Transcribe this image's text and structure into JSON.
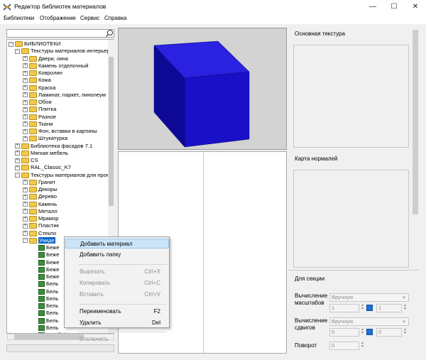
{
  "window": {
    "title": "Редактор библиотек материалов",
    "minimize": "—",
    "maximize": "☐",
    "close": "✕"
  },
  "menu": [
    "Библиотеки",
    "Отображение",
    "Сервис",
    "Справка"
  ],
  "tree": [
    {
      "label": "БИБЛИОТЕКИ",
      "exp": "−",
      "level": 0
    },
    {
      "label": "Текстуры материалов интерьер",
      "exp": "−",
      "level": 1
    },
    {
      "label": "Двери, окна",
      "exp": "+",
      "level": 2
    },
    {
      "label": "Камень отделочный",
      "exp": "+",
      "level": 2
    },
    {
      "label": "Ковролин",
      "exp": "+",
      "level": 2
    },
    {
      "label": "Кожа",
      "exp": "+",
      "level": 2
    },
    {
      "label": "Краска",
      "exp": "+",
      "level": 2
    },
    {
      "label": "Ламинат, паркет, линолеум",
      "exp": "+",
      "level": 2
    },
    {
      "label": "Обои",
      "exp": "+",
      "level": 2
    },
    {
      "label": "Плитка",
      "exp": "+",
      "level": 2
    },
    {
      "label": "Разное",
      "exp": "+",
      "level": 2
    },
    {
      "label": "Ткани",
      "exp": "+",
      "level": 2
    },
    {
      "label": "Фон, вставки в картины",
      "exp": "+",
      "level": 2
    },
    {
      "label": "Штукатурка",
      "exp": "+",
      "level": 2
    },
    {
      "label": "Библиотека фасадов 7.1",
      "exp": "+",
      "level": 1
    },
    {
      "label": "Мягкая мебель",
      "exp": "+",
      "level": 1
    },
    {
      "label": "CS",
      "exp": "+",
      "level": 1
    },
    {
      "label": "RAL_Classic_K7",
      "exp": "+",
      "level": 1
    },
    {
      "label": "Текстуры материалов для прое",
      "exp": "−",
      "level": 1
    },
    {
      "label": "Гранит",
      "exp": "+",
      "level": 2
    },
    {
      "label": "Декоры",
      "exp": "+",
      "level": 2
    },
    {
      "label": "Дерево",
      "exp": "+",
      "level": 2
    },
    {
      "label": "Камень",
      "exp": "+",
      "level": 2
    },
    {
      "label": "Металл",
      "exp": "+",
      "level": 2
    },
    {
      "label": "Мрамор",
      "exp": "+",
      "level": 2
    },
    {
      "label": "Пластик",
      "exp": "+",
      "level": 2
    },
    {
      "label": "Стекло",
      "exp": "+",
      "level": 2
    },
    {
      "label": "Униде",
      "exp": "−",
      "level": 2,
      "selected": true
    },
    {
      "label": "Беже",
      "level": 3,
      "material": true
    },
    {
      "label": "Беже",
      "level": 3,
      "material": true
    },
    {
      "label": "Беже",
      "level": 3,
      "material": true
    },
    {
      "label": "Беже",
      "level": 3,
      "material": true
    },
    {
      "label": "Беже",
      "level": 3,
      "material": true
    },
    {
      "label": "Бель",
      "level": 3,
      "material": true
    },
    {
      "label": "Бель",
      "level": 3,
      "material": true
    },
    {
      "label": "Бель",
      "level": 3,
      "material": true
    },
    {
      "label": "Бель",
      "level": 3,
      "material": true
    },
    {
      "label": "Бель",
      "level": 3,
      "material": true
    },
    {
      "label": "Бель",
      "level": 3,
      "material": true
    },
    {
      "label": "Бель",
      "level": 3,
      "material": true
    },
    {
      "label": "Голубой Аква",
      "level": 3,
      "material": true
    }
  ],
  "context_menu": [
    {
      "label": "Добавить материал",
      "shortcut": "",
      "disabled": false,
      "highlight": true
    },
    {
      "label": "Добавить папку",
      "shortcut": "",
      "disabled": false
    },
    {
      "sep": true
    },
    {
      "label": "Вырезать",
      "shortcut": "Ctrl+X",
      "disabled": true
    },
    {
      "label": "Копировать",
      "shortcut": "Ctrl+C",
      "disabled": true
    },
    {
      "label": "Вставить",
      "shortcut": "Ctrl+V",
      "disabled": true
    },
    {
      "sep": true
    },
    {
      "label": "Переименовать",
      "shortcut": "F2",
      "disabled": false
    },
    {
      "label": "Удалить",
      "shortcut": "Del",
      "disabled": false
    },
    {
      "sep": true
    },
    {
      "label": "Отключить",
      "shortcut": "",
      "disabled": true
    }
  ],
  "right": {
    "base_texture_label": "Основная текстура",
    "normal_map_label": "Карта нормалей",
    "section_label": "Для секции",
    "scale_label_1": "Вычисление",
    "scale_label_2": "масштабов",
    "scale_mode": "Вручную",
    "scale_x": "1",
    "scale_y": "1",
    "shift_label_1": "Вычисление",
    "shift_label_2": "сдвигов",
    "shift_mode": "Вручную",
    "shift_x": "0",
    "shift_y": "0",
    "rotation_label": "Поворот",
    "rotation_value": "0"
  },
  "colors": {
    "cube_front": "#1a10c8",
    "cube_top": "#2a22e0",
    "cube_side": "#0d0896",
    "selection": "#0a64c8"
  },
  "icons": [
    "app-icon",
    "search-icon",
    "folder-icon",
    "material-icon",
    "lock-icon"
  ]
}
